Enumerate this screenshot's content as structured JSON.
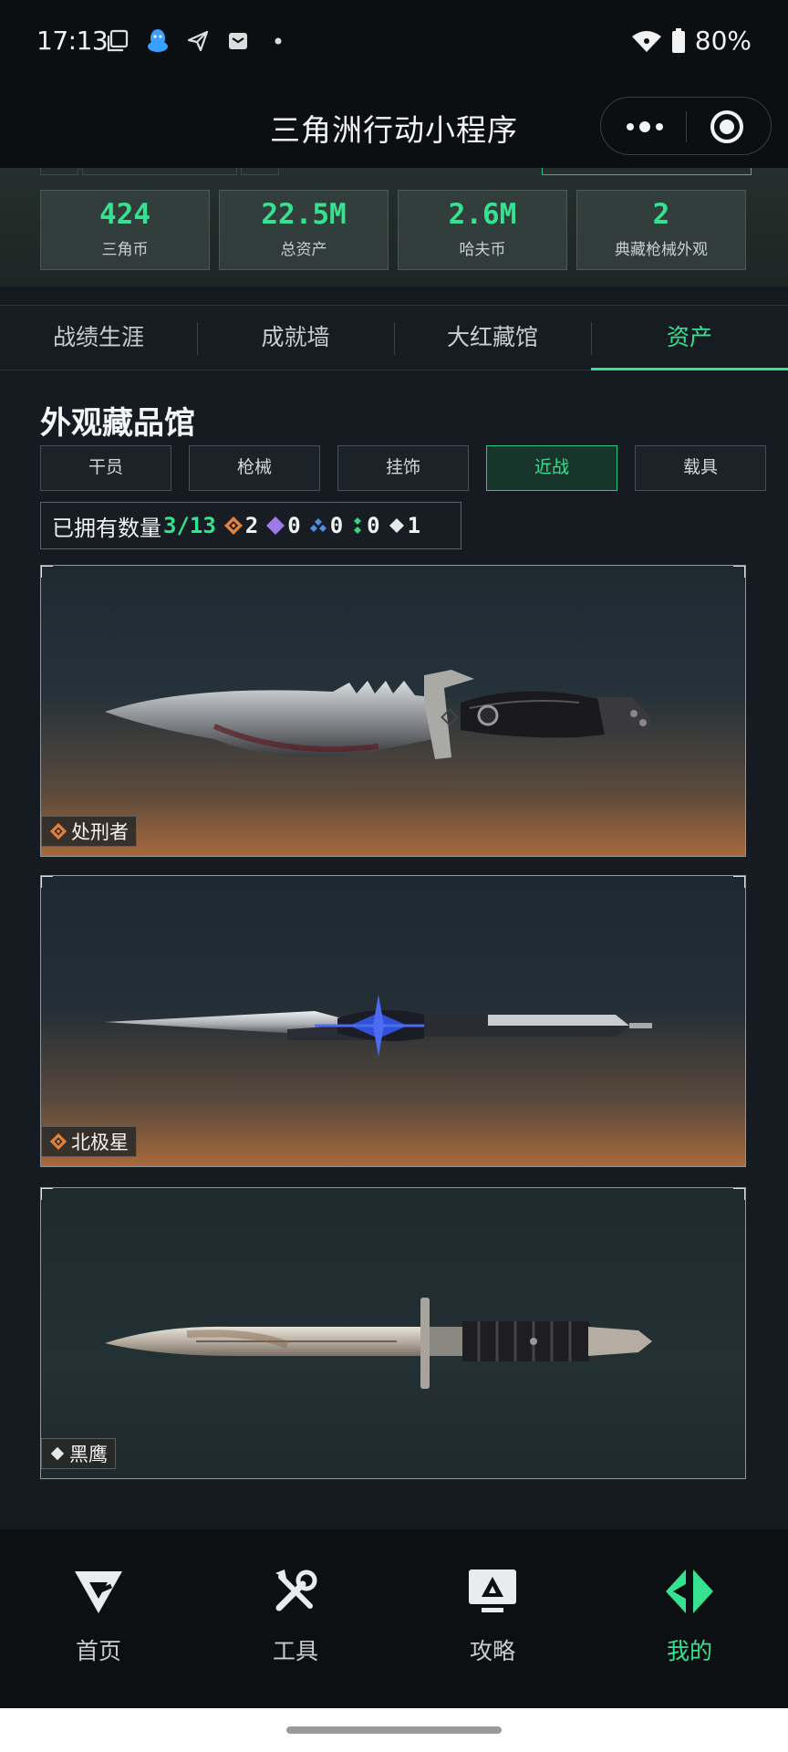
{
  "status_bar": {
    "time": "17:13",
    "battery": "80%"
  },
  "nav": {
    "title": "三角洲行动小程序"
  },
  "stats": [
    {
      "value": "424",
      "label": "三角币"
    },
    {
      "value": "22.5M",
      "label": "总资产"
    },
    {
      "value": "2.6M",
      "label": "哈夫币"
    },
    {
      "value": "2",
      "label": "典藏枪械外观"
    }
  ],
  "tabs": [
    {
      "label": "战绩生涯",
      "active": false
    },
    {
      "label": "成就墙",
      "active": false
    },
    {
      "label": "大红藏馆",
      "active": false
    },
    {
      "label": "资产",
      "active": true
    }
  ],
  "section": {
    "title": "外观藏品馆",
    "filters": [
      {
        "label": "干员",
        "active": false
      },
      {
        "label": "枪械",
        "active": false
      },
      {
        "label": "挂饰",
        "active": false
      },
      {
        "label": "近战",
        "active": true
      },
      {
        "label": "载具",
        "active": false
      }
    ],
    "owned": {
      "label": "已拥有数量",
      "count": "3/13",
      "rarities": [
        {
          "icon": "orange-diamond-icon",
          "color": "#e2813a",
          "value": "2"
        },
        {
          "icon": "purple-diamond-icon",
          "color": "#a07ae8",
          "value": "0"
        },
        {
          "icon": "blue-diamond-icon",
          "color": "#4e8fe0",
          "value": "0"
        },
        {
          "icon": "green-diamond-icon",
          "color": "#3fcf7a",
          "value": "0"
        },
        {
          "icon": "white-diamond-icon",
          "color": "#e8e8e8",
          "value": "1"
        }
      ]
    }
  },
  "items": [
    {
      "name": "处刑者",
      "rarity_color": "#e2813a",
      "glow": "#b8703c"
    },
    {
      "name": "北极星",
      "rarity_color": "#e2813a",
      "glow": "#b8703c"
    },
    {
      "name": "黑鹰",
      "rarity_color": "#e8e8e8",
      "glow": ""
    }
  ],
  "bottom_tabs": [
    {
      "label": "首页",
      "icon": "delta-home-icon",
      "active": false
    },
    {
      "label": "工具",
      "icon": "tools-icon",
      "active": false
    },
    {
      "label": "攻略",
      "icon": "guide-monitor-icon",
      "active": false
    },
    {
      "label": "我的",
      "icon": "profile-logo-icon",
      "active": true
    }
  ],
  "colors": {
    "accent": "#36e28f",
    "background": "#151b20"
  }
}
